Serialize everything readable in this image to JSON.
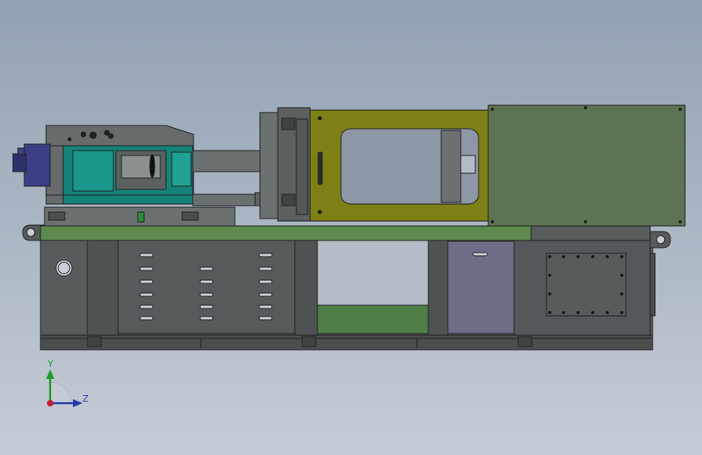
{
  "viewport": {
    "background_top": "#92a1b2",
    "background_bottom": "#c5ccd6"
  },
  "model": {
    "name": "injection-molding-machine",
    "colors": {
      "frame": "#575b5c",
      "frame_dark": "#3f4344",
      "bed_top": "#5e8a4e",
      "safety_guard": "#7e7f14",
      "guard_window": "#8e97a6",
      "electrical_cabinet": "#5c7354",
      "injection_unit": "#16837a",
      "motor": "#3c3f86",
      "door_panel": "#6e6d88"
    }
  },
  "triad": {
    "y_label": "Y",
    "z_label": "Z",
    "y_color": "#1e9a2a",
    "z_color": "#2a3bb0",
    "x_color": "#c0202a"
  }
}
